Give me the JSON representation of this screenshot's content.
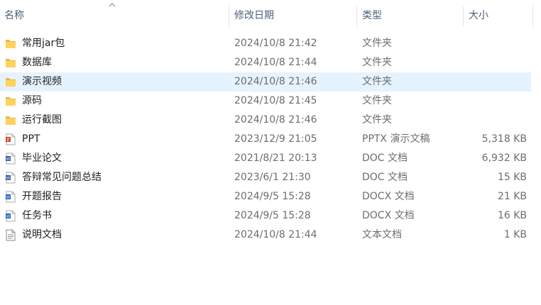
{
  "columns": {
    "name": "名称",
    "date": "修改日期",
    "type": "类型",
    "size": "大小"
  },
  "files": [
    {
      "name": "常用jar包",
      "date": "2024/10/8 21:42",
      "type": "文件夹",
      "size": "",
      "icon": "folder-icon"
    },
    {
      "name": "数据库",
      "date": "2024/10/8 21:44",
      "type": "文件夹",
      "size": "",
      "icon": "folder-icon"
    },
    {
      "name": "演示视频",
      "date": "2024/10/8 21:46",
      "type": "文件夹",
      "size": "",
      "icon": "folder-icon",
      "selected": true
    },
    {
      "name": "源码",
      "date": "2024/10/8 21:45",
      "type": "文件夹",
      "size": "",
      "icon": "folder-icon"
    },
    {
      "name": "运行截图",
      "date": "2024/10/8 21:46",
      "type": "文件夹",
      "size": "",
      "icon": "folder-icon"
    },
    {
      "name": "PPT",
      "date": "2023/12/9 21:05",
      "type": "PPTX 演示文稿",
      "size": "5,318 KB",
      "icon": "pptx-file-icon"
    },
    {
      "name": "毕业论文",
      "date": "2021/8/21 20:13",
      "type": "DOC 文档",
      "size": "6,932 KB",
      "icon": "doc-file-icon"
    },
    {
      "name": "答辩常见问题总结",
      "date": "2023/6/1 21:30",
      "type": "DOC 文档",
      "size": "15 KB",
      "icon": "doc-file-icon"
    },
    {
      "name": "开题报告",
      "date": "2024/9/5 15:28",
      "type": "DOCX 文档",
      "size": "21 KB",
      "icon": "docx-file-icon"
    },
    {
      "name": "任务书",
      "date": "2024/9/5 15:28",
      "type": "DOCX 文档",
      "size": "16 KB",
      "icon": "docx-file-icon"
    },
    {
      "name": "说明文档",
      "date": "2024/10/8 21:44",
      "type": "文本文档",
      "size": "1 KB",
      "icon": "txt-file-icon"
    }
  ]
}
